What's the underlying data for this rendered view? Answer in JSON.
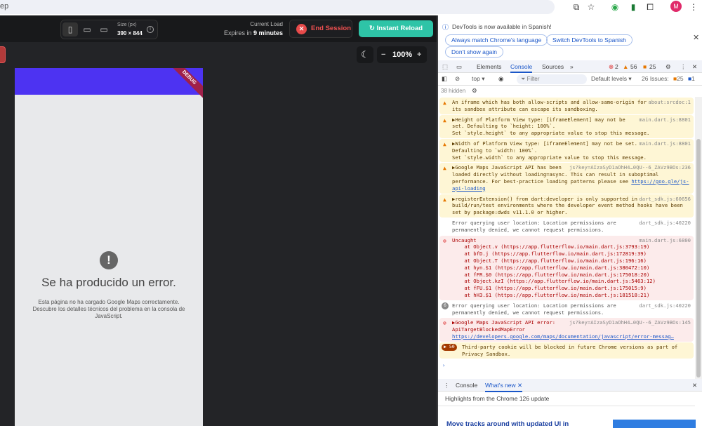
{
  "browser": {
    "address_fragment": "ep",
    "avatar_letter": "M"
  },
  "toolbar": {
    "size_label": "Size (px)",
    "size_value": "390 × 844",
    "current_load": "Current Load",
    "expires_prefix": "Expires in ",
    "expires_value": "9 minutes",
    "end_session": "End Session",
    "instant_reload": "Instant Reload",
    "zoom_minus": "−",
    "zoom_level": "100%",
    "zoom_plus": "+"
  },
  "app": {
    "debug_banner": "DEBUG",
    "error_title": "Se ha producido un error.",
    "error_desc": "Esta página no ha cargado Google Maps correctamente. Descubre los detalles técnicos del problema en la consola de JavaScript.",
    "header_color": "#4d33f2"
  },
  "devtools": {
    "infobar": {
      "message": "DevTools is now available in Spanish!",
      "btn_match": "Always match Chrome's language",
      "btn_switch": "Switch DevTools to Spanish",
      "btn_dont": "Don't show again"
    },
    "tabs": [
      "Elements",
      "Console",
      "Sources"
    ],
    "active_tab": "Console",
    "counts": {
      "errors": "2",
      "warnings": "56",
      "issues": "25"
    },
    "filter": {
      "context": "top",
      "placeholder": "Filter",
      "levels": "Default levels",
      "issues_label": "26 Issues:",
      "issues_warn": "25",
      "issues_info": "1"
    },
    "hidden": "38 hidden",
    "messages": [
      {
        "type": "warn",
        "text": "An iframe which has both allow-scripts and allow-same-origin for its sandbox attribute can escape its sandboxing.",
        "source": "about:srcdoc:1"
      },
      {
        "type": "warn",
        "text": "▶Height of Platform View type: [iframeElement] may not be set. Defaulting to `height: 100%`.\nSet `style.height` to any appropriate value to stop this message.",
        "source": "main.dart.js:8801"
      },
      {
        "type": "warn",
        "text": "▶Width of Platform View type: [iframeElement] may not be set. Defaulting to `width: 100%`.\nSet `style.width` to any appropriate value to stop this message.",
        "source": "main.dart.js:8801"
      },
      {
        "type": "warn",
        "text": "▶Google Maps JavaScript API has been loaded directly without loading=async. This can result in suboptimal performance. For best-practice loading patterns please see ",
        "link": "https://goo.gle/js-api-loading",
        "source": "js?key=AIzaSyD1aOhH4…0QU--6_ZAVz9BOs:236"
      },
      {
        "type": "warn",
        "text": "▶registerExtension() from dart:developer is only supported in build/run/test environments where the developer event method hooks have been set by package:dwds v11.1.0 or higher.",
        "source": "dart_sdk.js:60656"
      },
      {
        "type": "plain",
        "text": "Error querying user location: Location permissions are permanently denied, we cannot request permissions.",
        "source": "dart_sdk.js:40220"
      },
      {
        "type": "err",
        "text": "Uncaught\n    at Object.v (https://app.flutterflow.io/main.dart.js:3793:19)\n    at bfD.j (https://app.flutterflow.io/main.dart.js:172819:39)\n    at Object.T (https://app.flutterflow.io/main.dart.js:196:16)\n    at hyn.$1 (https://app.flutterflow.io/main.dart.js:380472:10)\n    at fFR.$0 (https://app.flutterflow.io/main.dart.js:175018:20)\n    at Object.kzI (https://app.flutterflow.io/main.dart.js:5463:12)\n    at fFU.$1 (https://app.flutterflow.io/main.dart.js:175015:9)\n    at hH3.$1 (https://app.flutterflow.io/main.dart.js:181518:21)",
        "source": "main.dart.js:6800"
      },
      {
        "type": "plain",
        "badge": "6",
        "text": "Error querying user location: Location permissions are permanently denied, we cannot request permissions.",
        "source": "dart_sdk.js:40220"
      },
      {
        "type": "err",
        "text": "▶Google Maps JavaScript API error: ApiTargetBlockedMapError\n",
        "link": "https://developers.google.com/maps/documentation/javascript/error-messag…",
        "source": "js?key=AIzaSyD1aOhH4…0QU--6_ZAVz9BOs:145"
      },
      {
        "type": "warn",
        "badge": "50",
        "text": "Third-party cookie will be blocked in future Chrome versions as part of Privacy Sandbox.",
        "source": ""
      }
    ],
    "prompt": "›",
    "drawer": {
      "tab_console": "Console",
      "tab_whats_new": "What's new",
      "highlights": "Highlights from the Chrome 126 update",
      "headline": "Move tracks around with updated UI in"
    }
  }
}
